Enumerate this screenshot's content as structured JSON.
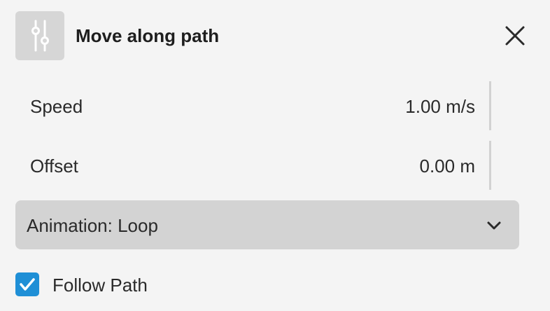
{
  "header": {
    "title": "Move along path",
    "icon": "sliders-icon",
    "close_icon": "close-icon"
  },
  "fields": {
    "speed": {
      "label": "Speed",
      "value": "1.00 m/s"
    },
    "offset": {
      "label": "Offset",
      "value": "0.00 m"
    }
  },
  "animation": {
    "label": "Animation: Loop",
    "icon": "chevron-down-icon"
  },
  "follow_path": {
    "label": "Follow Path",
    "checked": true,
    "icon": "checkmark-icon"
  },
  "colors": {
    "background": "#f4f4f4",
    "icon_box": "#d6d6d6",
    "dropdown": "#d3d3d3",
    "checkbox_accent": "#1f8fd6"
  }
}
